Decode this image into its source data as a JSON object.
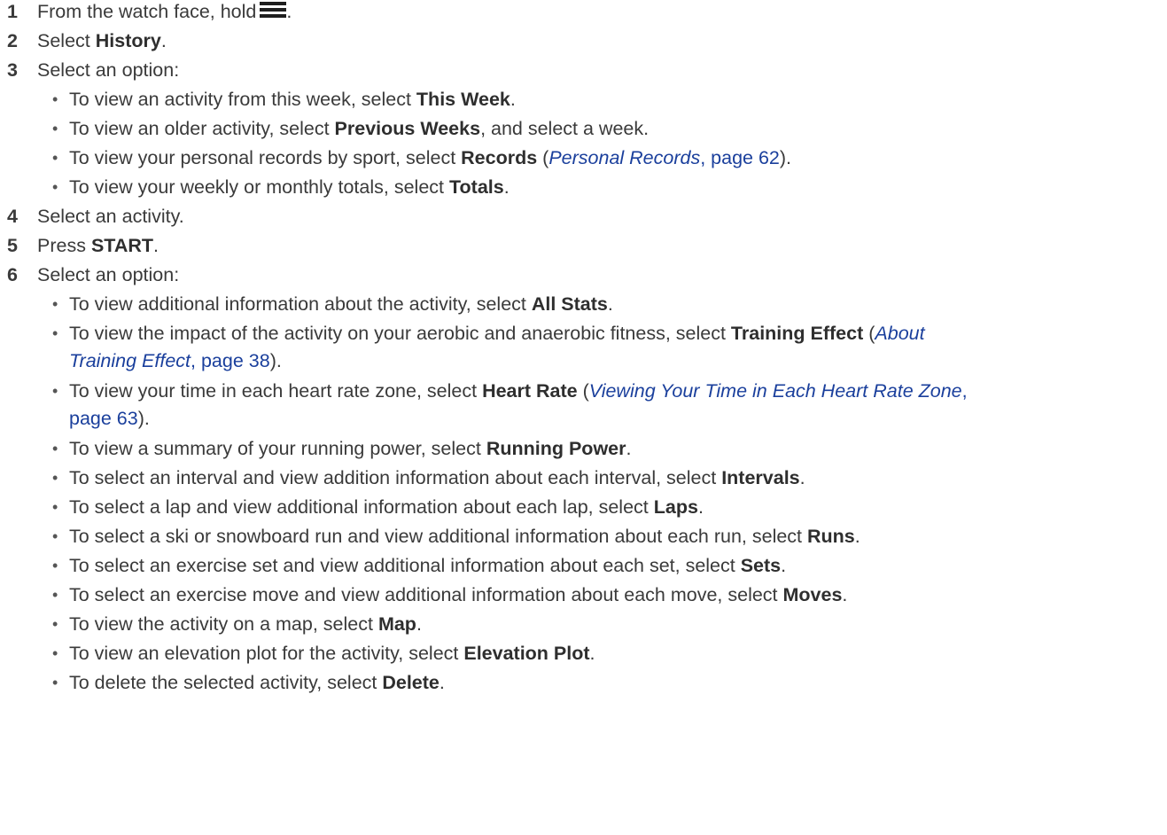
{
  "steps": {
    "s1": {
      "num": "1",
      "text": "From the watch face, hold",
      "icon": "menu-icon",
      "after": "."
    },
    "s2": {
      "num": "2",
      "pre": "Select ",
      "bold": "History",
      "after": "."
    },
    "s3": {
      "num": "3",
      "text": "Select an option:"
    },
    "s4": {
      "num": "4",
      "text": "Select an activity."
    },
    "s5": {
      "num": "5",
      "pre": "Press ",
      "bold": "START",
      "after": "."
    },
    "s6": {
      "num": "6",
      "text": "Select an option:"
    }
  },
  "step3_options": {
    "o1": {
      "pre": "To view an activity from this week, select ",
      "bold": "This Week",
      "after": "."
    },
    "o2": {
      "pre": "To view an older activity, select ",
      "bold": "Previous Weeks",
      "after": ", and select a week."
    },
    "o3": {
      "pre": "To view your personal records by sport, select ",
      "bold": "Records",
      "paren_open": " (",
      "link_title": "Personal Records",
      "link_page": ", page 62",
      "after": ")."
    },
    "o4": {
      "pre": "To view your weekly or monthly totals, select ",
      "bold": "Totals",
      "after": "."
    }
  },
  "step6_options": {
    "o1": {
      "pre": "To view additional information about the activity, select ",
      "bold": "All Stats",
      "after": "."
    },
    "o2": {
      "pre": "To view the impact of the activity on your aerobic and anaerobic fitness, select ",
      "bold": "Training Effect",
      "paren_open": " (",
      "link_title_a": "About",
      "link_title_b": "Training Effect",
      "link_page": ", page 38",
      "after": ")."
    },
    "o3": {
      "pre": "To view your time in each heart rate zone, select ",
      "bold": "Heart Rate",
      "paren_open": " (",
      "link_title": "Viewing Your Time in Each Heart Rate Zone",
      "link_sep": ",",
      "link_page": "page 63",
      "after": ")."
    },
    "o4": {
      "pre": "To view a summary of your running power, select ",
      "bold": "Running Power",
      "after": "."
    },
    "o5": {
      "pre": "To select an interval and view addition information about each interval, select ",
      "bold": "Intervals",
      "after": "."
    },
    "o6": {
      "pre": "To select a lap and view additional information about each lap, select ",
      "bold": "Laps",
      "after": "."
    },
    "o7": {
      "pre": "To select a ski or snowboard run and view additional information about each run, select ",
      "bold": "Runs",
      "after": "."
    },
    "o8": {
      "pre": "To select an exercise set and view additional information about each set, select ",
      "bold": "Sets",
      "after": "."
    },
    "o9": {
      "pre": "To select an exercise move and view additional information about each move, select ",
      "bold": "Moves",
      "after": "."
    },
    "o10": {
      "pre": "To view the activity on a map, select ",
      "bold": "Map",
      "after": "."
    },
    "o11": {
      "pre": "To view an elevation plot for the activity, select ",
      "bold": "Elevation Plot",
      "after": "."
    },
    "o12": {
      "pre": "To delete the selected activity, select ",
      "bold": "Delete",
      "after": "."
    }
  },
  "bullet_char": "•"
}
